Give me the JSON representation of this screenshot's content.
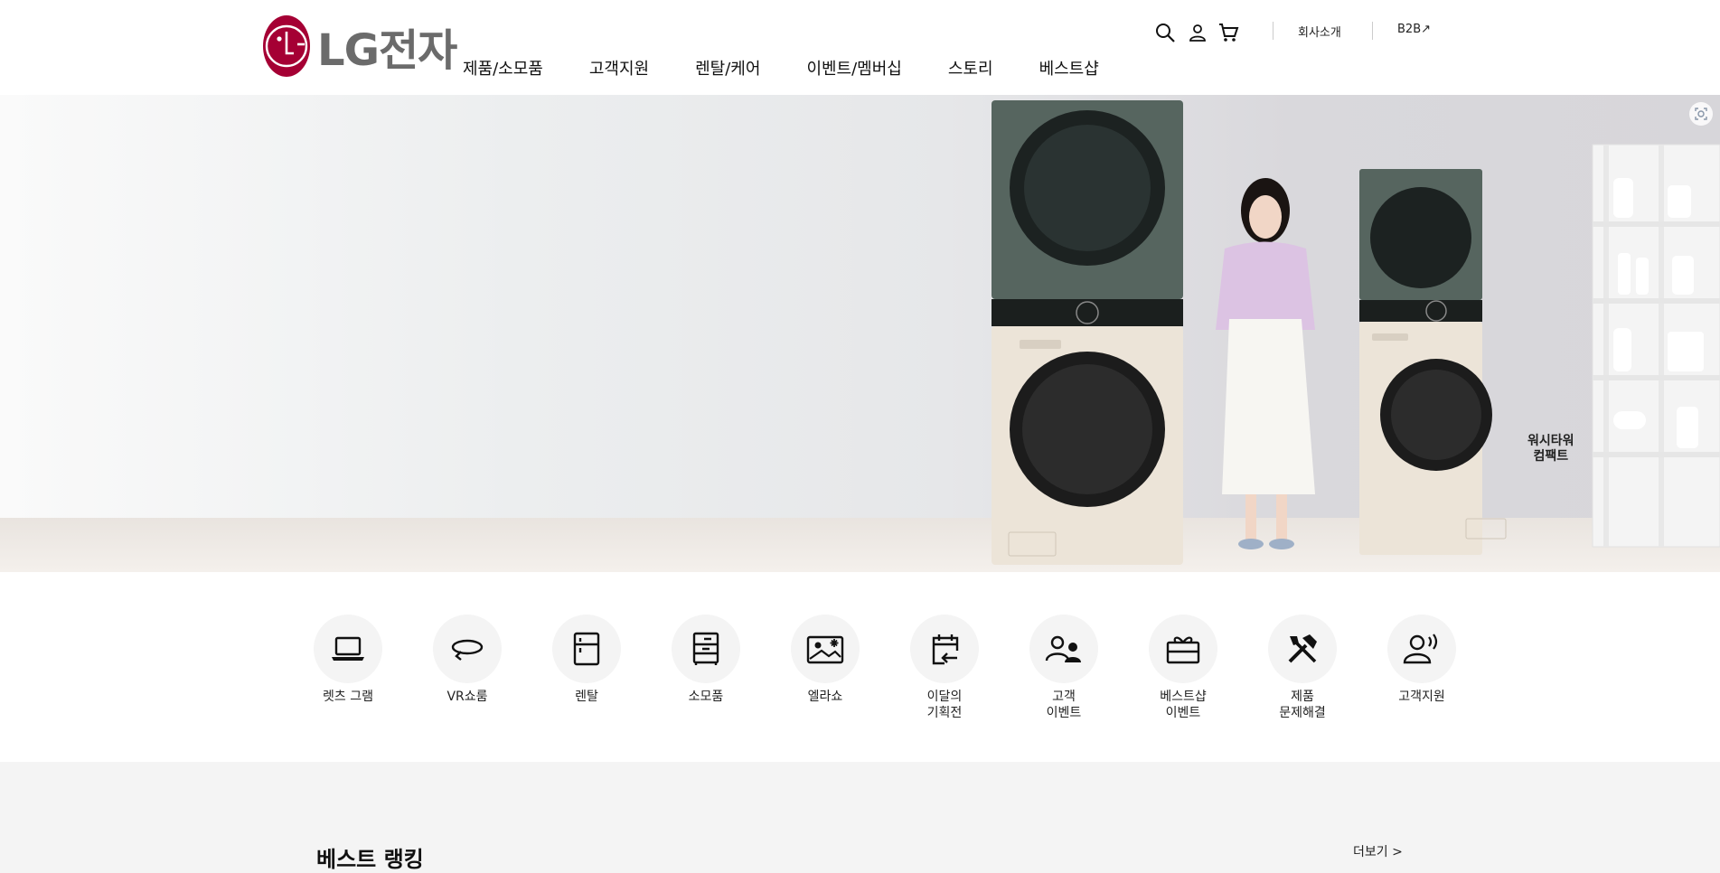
{
  "brand": {
    "logo_mark": "L",
    "logo_text": "LG전자"
  },
  "gnb": [
    "제품/소모품",
    "고객지원",
    "렌탈/케어",
    "이벤트/멤버십",
    "스토리",
    "베스트샵"
  ],
  "utility": {
    "icons": [
      "search-icon",
      "user-icon",
      "cart-icon"
    ],
    "company_label": "회사소개",
    "b2b_label": "B2B↗"
  },
  "hero": {
    "product_label_line1": "워시타워",
    "product_label_line2": "컴팩트",
    "colors": {
      "washer_top": "#56655f",
      "washer_bottom": "#ece4d8",
      "brand": "#a50034"
    }
  },
  "quick_menu": [
    {
      "label": "렛츠 그램",
      "icon": "laptop-icon"
    },
    {
      "label": "VR쇼룸",
      "icon": "vr-rotate-icon"
    },
    {
      "label": "렌탈",
      "icon": "refrigerator-icon"
    },
    {
      "label": "소모품",
      "icon": "drawer-icon"
    },
    {
      "label": "엘라쇼",
      "icon": "image-sparkle-icon"
    },
    {
      "label": "이달의\n기획전",
      "icon": "calendar-arrow-icon"
    },
    {
      "label": "고객\n이벤트",
      "icon": "users-icon"
    },
    {
      "label": "베스트샵\n이벤트",
      "icon": "gift-icon"
    },
    {
      "label": "제품\n문제해결",
      "icon": "tools-icon"
    },
    {
      "label": "고객지원",
      "icon": "support-agent-icon"
    }
  ],
  "best_ranking": {
    "title": "베스트 랭킹",
    "more_label": "더보기 >"
  }
}
